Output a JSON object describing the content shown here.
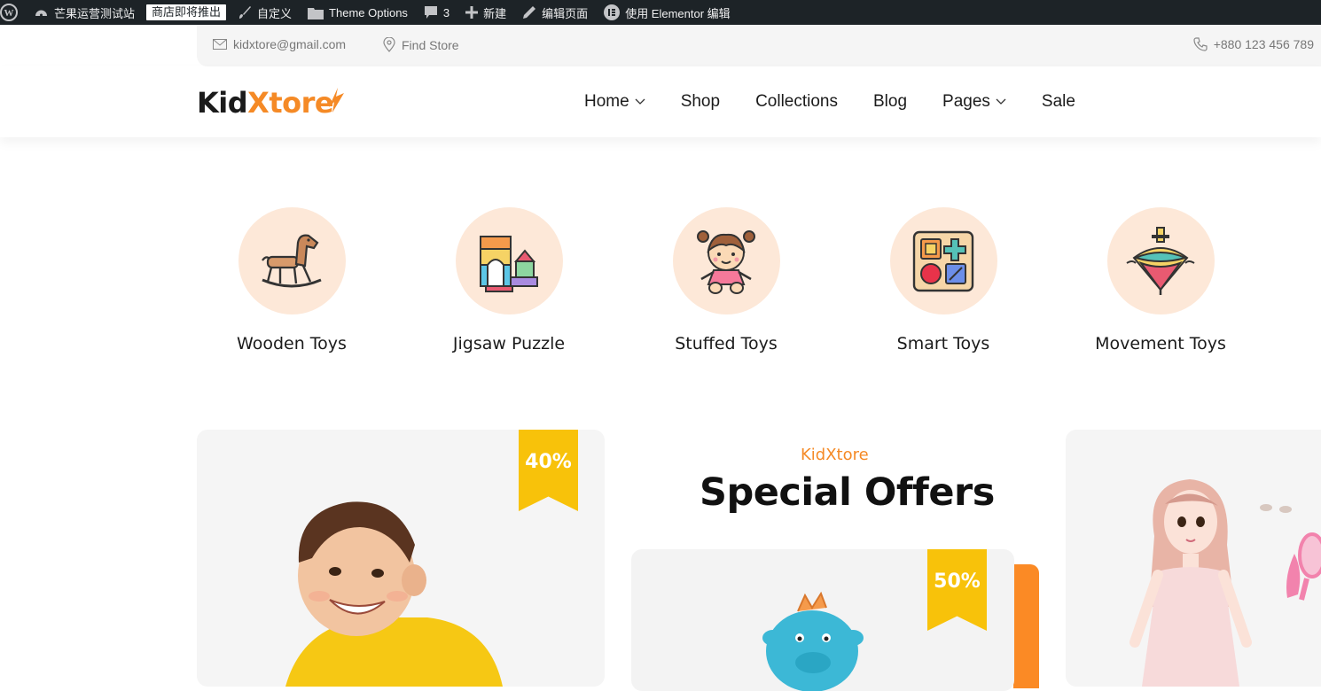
{
  "adminbar": {
    "site_name": "芒果运营测试站",
    "coming_soon": "商店即将推出",
    "customize": "自定义",
    "theme_options": "Theme Options",
    "comments_count": "3",
    "new_label": "新建",
    "edit_page": "编辑页面",
    "elementor_edit": "使用 Elementor 编辑"
  },
  "topbar": {
    "email": "kidxtore@gmail.com",
    "find_store": "Find Store",
    "phone": "+880 123 456 789"
  },
  "logo": {
    "part1": "Kid",
    "part2": "Xtore"
  },
  "nav": [
    {
      "label": "Home"
    },
    {
      "label": "Shop"
    },
    {
      "label": "Collections"
    },
    {
      "label": "Blog"
    },
    {
      "label": "Pages"
    },
    {
      "label": "Sale"
    }
  ],
  "categories": [
    {
      "label": "Wooden Toys",
      "icon": "rocking-horse-icon"
    },
    {
      "label": "Jigsaw Puzzle",
      "icon": "blocks-icon"
    },
    {
      "label": "Stuffed Toys",
      "icon": "doll-icon"
    },
    {
      "label": "Smart Toys",
      "icon": "shape-sorter-icon"
    },
    {
      "label": "Movement Toys",
      "icon": "spinning-top-icon"
    }
  ],
  "offers": {
    "subtitle": "KidXtore",
    "title": "Special Offers",
    "left_discount": "40%",
    "mid_discount": "50%"
  },
  "colors": {
    "accent": "#f58a26",
    "ribbon": "#f8c20a",
    "admin_bg": "#1d2327",
    "circle_bg": "#fde8d8"
  }
}
